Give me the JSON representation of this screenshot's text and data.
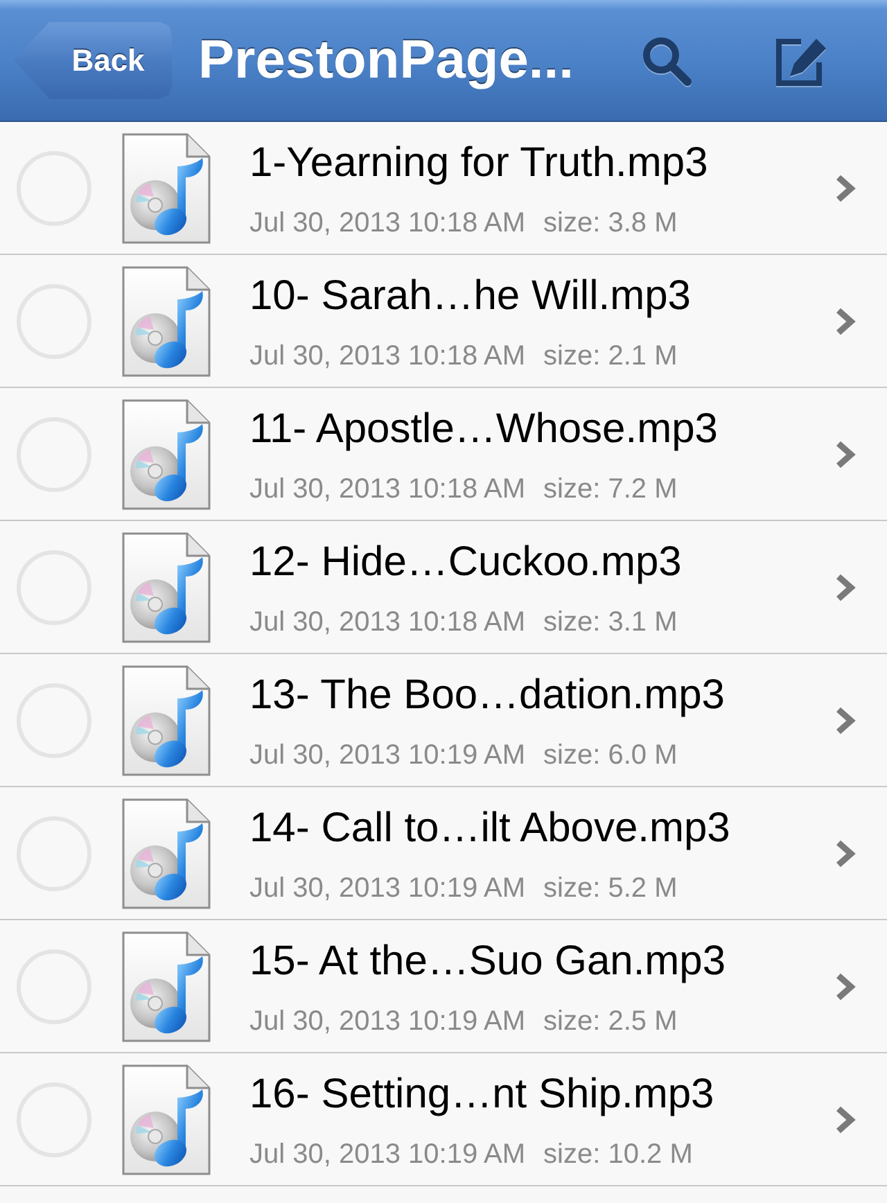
{
  "nav_bar": {
    "back_button": "Back",
    "title": "PrestonPage..."
  },
  "files": [
    {
      "name": "1-Yearning for Truth.mp3",
      "date": "Jul 30, 2013 10:18 AM",
      "size": "size: 3.8 M",
      "selected": false
    },
    {
      "name": "10- Sarah…he Will.mp3",
      "date": "Jul 30, 2013 10:18 AM",
      "size": "size: 2.1 M",
      "selected": false
    },
    {
      "name": "11- Apostle…Whose.mp3",
      "date": "Jul 30, 2013 10:18 AM",
      "size": "size: 7.2 M",
      "selected": false
    },
    {
      "name": "12- Hide…Cuckoo.mp3",
      "date": "Jul 30, 2013 10:18 AM",
      "size": "size: 3.1 M",
      "selected": false
    },
    {
      "name": "13- The Boo…dation.mp3",
      "date": "Jul 30, 2013 10:19 AM",
      "size": "size: 6.0 M",
      "selected": false
    },
    {
      "name": "14- Call to…ilt Above.mp3",
      "date": "Jul 30, 2013 10:19 AM",
      "size": "size: 5.2 M",
      "selected": false
    },
    {
      "name": "15- At the…Suo Gan.mp3",
      "date": "Jul 30, 2013 10:19 AM",
      "size": "size: 2.5 M",
      "selected": false
    },
    {
      "name": "16- Setting…nt Ship.mp3",
      "date": "Jul 30, 2013 10:19 AM",
      "size": "size: 10.2 M",
      "selected": false
    }
  ]
}
